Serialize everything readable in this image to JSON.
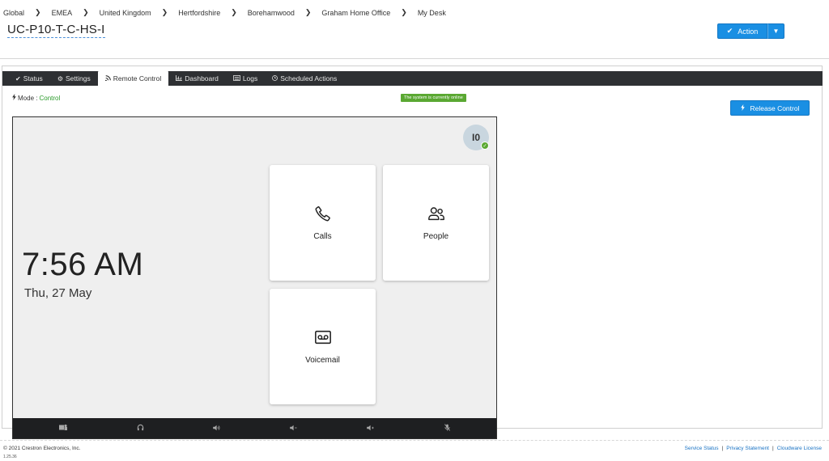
{
  "breadcrumb": [
    "Global",
    "EMEA",
    "United Kingdom",
    "Hertfordshire",
    "Borehamwood",
    "Graham Home Office",
    "My Desk"
  ],
  "device": {
    "title": "UC-P10-T-C-HS-I"
  },
  "action_button": {
    "label": "Action"
  },
  "tabs": [
    {
      "label": "Status",
      "icon": "check-icon"
    },
    {
      "label": "Settings",
      "icon": "gear-icon"
    },
    {
      "label": "Remote Control",
      "icon": "signal-icon"
    },
    {
      "label": "Dashboard",
      "icon": "bar-chart-icon"
    },
    {
      "label": "Logs",
      "icon": "list-icon"
    },
    {
      "label": "Scheduled Actions",
      "icon": "clock-icon"
    }
  ],
  "mode": {
    "label": "Mode :",
    "value": "Control"
  },
  "status_badge": "The system is currently online",
  "release_button": {
    "label": "Release Control"
  },
  "screen": {
    "avatar_initials": "I0",
    "time": "7:56 AM",
    "date": "Thu, 27 May",
    "tiles": {
      "calls": "Calls",
      "people": "People",
      "voicemail": "Voicemail"
    }
  },
  "footer": {
    "copyright": "© 2021 Crestron Electronics, Inc.",
    "version": "1.25.36",
    "links": [
      "Service Status",
      "Privacy Statement",
      "Cloudware License"
    ]
  },
  "colors": {
    "accent": "#1a8fe3",
    "online": "#5aa832",
    "tabbar": "#2e3033"
  }
}
